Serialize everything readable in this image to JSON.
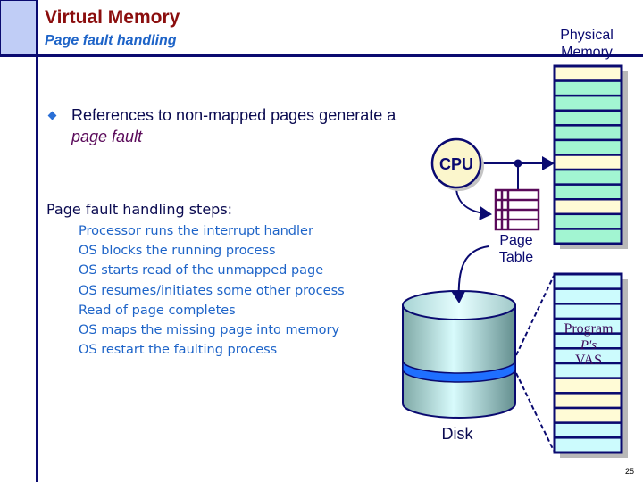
{
  "header": {
    "title": "Virtual Memory",
    "subtitle": "Page fault handling"
  },
  "bullet": {
    "text_before": "References to non-mapped pages generate a ",
    "text_em": "page fault"
  },
  "steps": {
    "heading": "Page fault handling steps:",
    "items": [
      "Processor runs the interrupt handler",
      "OS blocks the running process",
      "OS starts read of the unmapped page",
      "OS resumes/initiates some other process",
      "Read of page completes",
      "OS maps the missing page into memory",
      "OS restart the faulting process"
    ]
  },
  "diagram": {
    "cpu_label": "CPU",
    "page_table_label_line1": "Page",
    "page_table_label_line2": "Table",
    "physical_memory_label_line1": "Physical",
    "physical_memory_label_line2": "Memory",
    "disk_label": "Disk",
    "vas_label_line1": "Program",
    "vas_label_line2": "P's",
    "vas_label_line3": "VAS",
    "physical_memory_rows": [
      "yellow",
      "green",
      "green",
      "green",
      "green",
      "green",
      "yellow",
      "green",
      "green",
      "yellow",
      "green",
      "green"
    ],
    "vas_rows": [
      "cyan",
      "cyan",
      "cyan",
      "cyan",
      "cyan",
      "cyan",
      "cyan",
      "yellow",
      "yellow",
      "yellow",
      "cyan",
      "cyan"
    ],
    "colors": {
      "yellow": "#fffbd6",
      "green": "#a2f5d2",
      "cyan": "#ccfbfd",
      "border": "#0a0a70",
      "page_table": "#5a0a5a",
      "disk_band": "#1f6fff",
      "cpu_fill": "#fbf6cc"
    }
  },
  "page_number": "25"
}
